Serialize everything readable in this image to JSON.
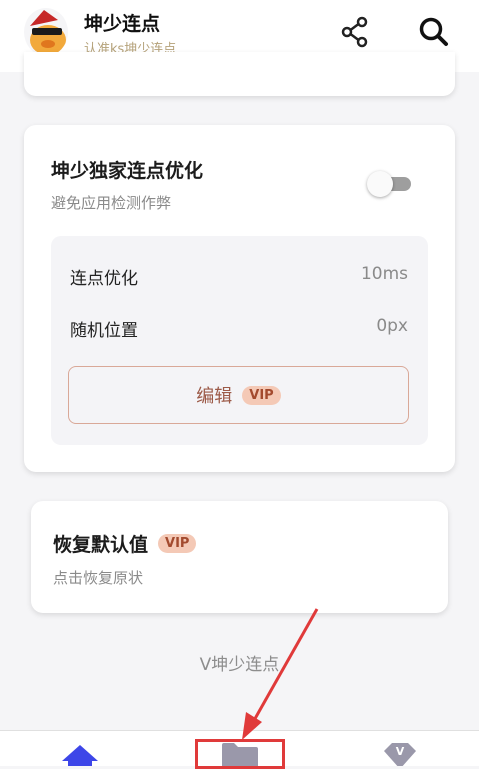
{
  "header": {
    "app_name": "坤少连点",
    "subtitle": "认准ks坤少连点"
  },
  "optimization_card": {
    "title": "坤少独家连点优化",
    "description": "避免应用检测作弊",
    "toggle_on": false,
    "rows": [
      {
        "label": "连点优化",
        "value": "10ms"
      },
      {
        "label": "随机位置",
        "value": "0px"
      }
    ],
    "edit_label": "编辑",
    "vip_badge": "VIP"
  },
  "reset_card": {
    "title": "恢复默认值",
    "vip_badge": "VIP",
    "description": "点击恢复原状"
  },
  "footer": {
    "text": "V坤少连点"
  },
  "bottom_nav": {
    "items": [
      "home-icon",
      "folder-icon",
      "vip-icon"
    ]
  },
  "colors": {
    "accent_blue": "#3d46e8",
    "vip_bg": "#f4c9b6",
    "vip_text": "#a34a2e",
    "annotation_red": "#e03a3a"
  }
}
